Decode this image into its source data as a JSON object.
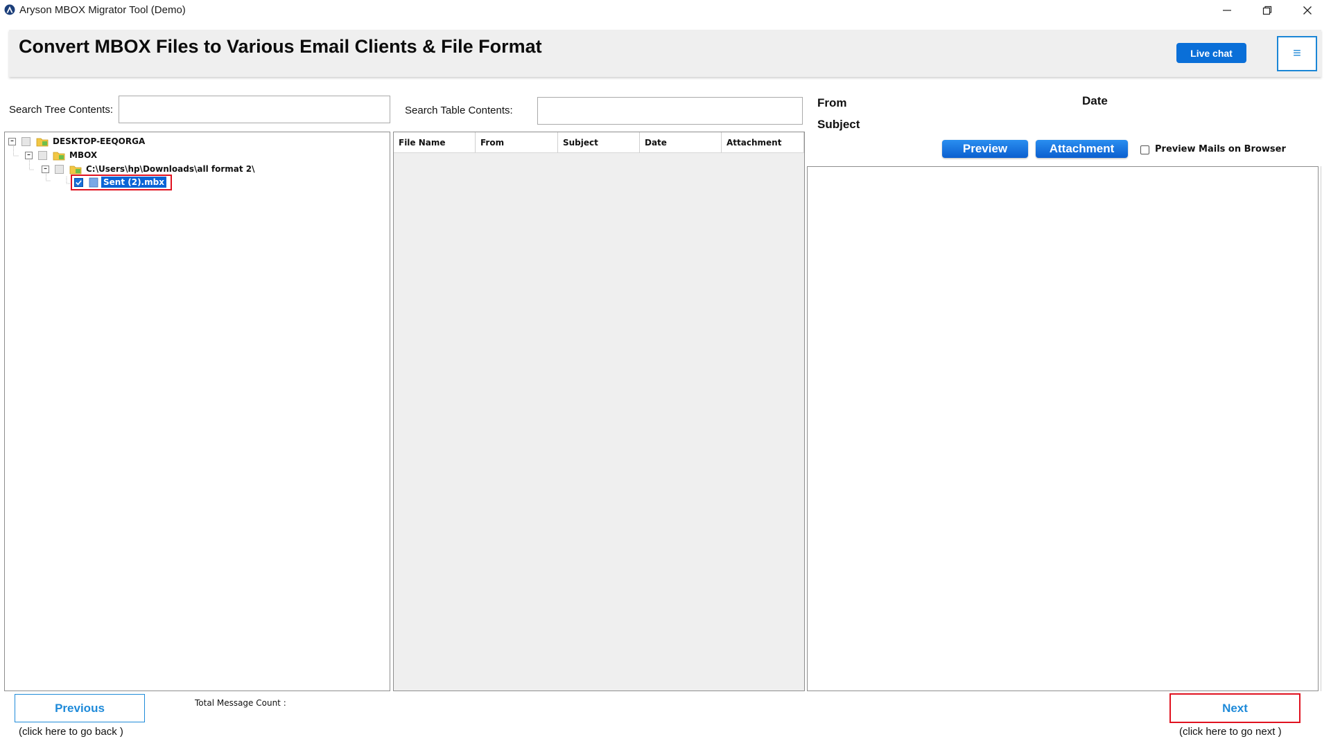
{
  "window": {
    "title": "Aryson MBOX Migrator Tool (Demo)"
  },
  "header": {
    "title": "Convert MBOX Files to Various Email Clients & File Format",
    "live_chat_label": "Live chat",
    "menu_icon": "hamburger-icon"
  },
  "search": {
    "tree_label": "Search Tree Contents:",
    "tree_value": "",
    "table_label": "Search Table Contents:",
    "table_value": ""
  },
  "tree": {
    "items": [
      {
        "label": "DESKTOP-EEQORGA",
        "level": 0,
        "expanded": true,
        "checked": false,
        "icon": "computer-folder-icon"
      },
      {
        "label": "MBOX",
        "level": 1,
        "expanded": true,
        "checked": false,
        "icon": "folder-icon"
      },
      {
        "label": "C:\\Users\\hp\\Downloads\\all format 2\\",
        "level": 2,
        "expanded": true,
        "checked": false,
        "icon": "folder-icon"
      },
      {
        "label": "Sent (2).mbx",
        "level": 3,
        "checked": true,
        "selected": true,
        "highlighted": true,
        "icon": "file-icon"
      }
    ]
  },
  "table": {
    "columns": [
      "File Name",
      "From",
      "Subject",
      "Date",
      "Attachment"
    ],
    "rows": []
  },
  "preview": {
    "from_label": "From",
    "date_label": "Date",
    "subject_label": "Subject",
    "preview_button": "Preview",
    "attachment_button": "Attachment",
    "browser_checkbox_label": "Preview Mails on Browser",
    "browser_checkbox_checked": false
  },
  "footer": {
    "previous_label": "Previous",
    "previous_hint": "(click here to  go back )",
    "total_message_label": "Total Message Count :",
    "total_message_value": "",
    "next_label": "Next",
    "next_hint": "(click here to  go next )"
  },
  "colors": {
    "accent_blue": "#0a6fd8",
    "highlight_red": "#e0111f",
    "selection_blue": "#0a64d6"
  }
}
